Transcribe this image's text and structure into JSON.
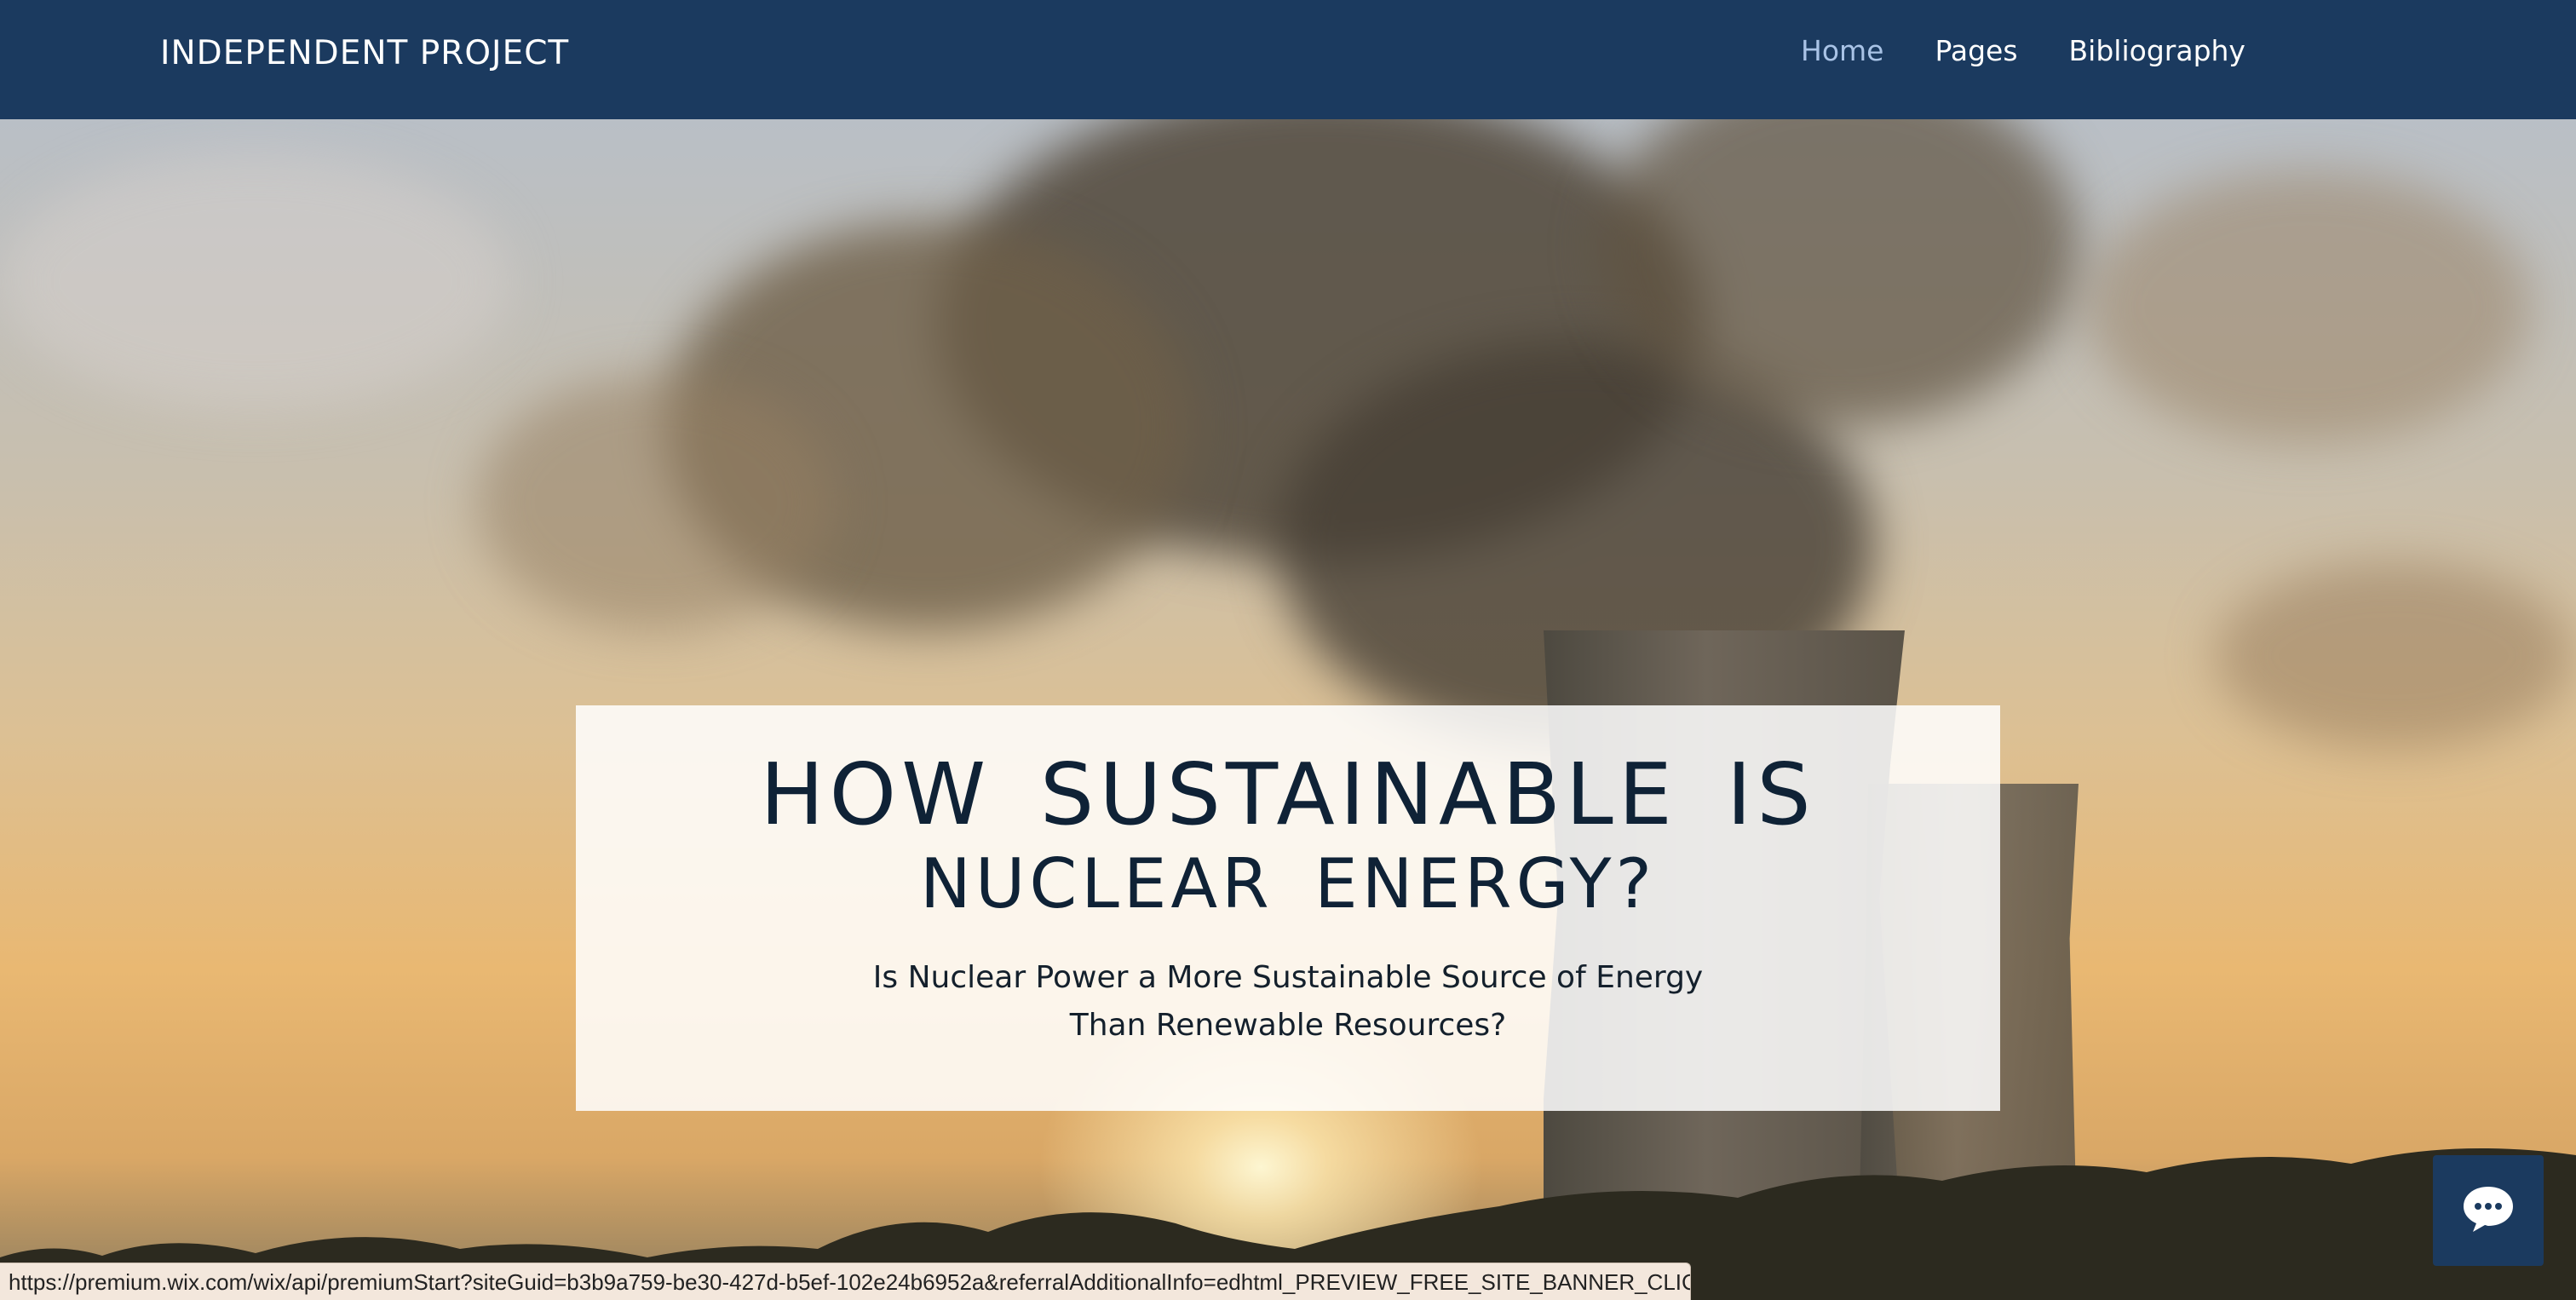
{
  "header": {
    "site_title": "INDEPENDENT PROJECT",
    "nav": [
      {
        "label": "Home",
        "active": true
      },
      {
        "label": "Pages",
        "active": false
      },
      {
        "label": "Bibliography",
        "active": false
      }
    ]
  },
  "hero": {
    "title_line1": "HOW SUSTAINABLE IS",
    "title_line2": "NUCLEAR ENERGY?",
    "subtitle": "Is Nuclear Power a More Sustainable Source of Energy Than Renewable Resources?",
    "background": "nuclear cooling towers emitting steam at sunset"
  },
  "chat": {
    "icon": "chat-bubble-icon"
  },
  "status_bar": {
    "url": "https://premium.wix.com/wix/api/premiumStart?siteGuid=b3b9a759-be30-427d-b5ef-102e24b6952a&referralAdditionalInfo=edhtml_PREVIEW_FREE_SITE_BANNER_CLICK"
  },
  "colors": {
    "header_bg": "#1b3a5f",
    "nav_active": "#a9c3e6",
    "title_text": "#0f2236",
    "card_bg": "#ffffff"
  }
}
